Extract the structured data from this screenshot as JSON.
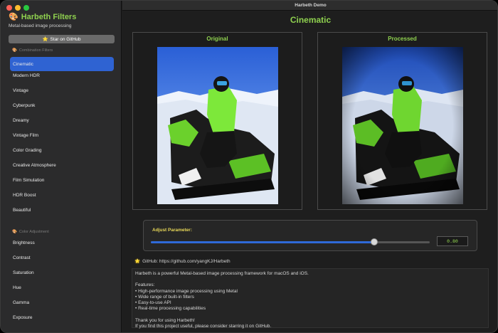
{
  "window": {
    "title": "Harbeth Demo"
  },
  "sidebar": {
    "app_title": "Harbeth Filters",
    "app_subtitle": "Metal-based image processing",
    "star_button": "Star on GitHub",
    "combination_header": "Combination Filters",
    "combination_items": [
      {
        "label": "Cinematic",
        "active": true
      },
      {
        "label": "Modern HDR"
      },
      {
        "label": "Vintage"
      },
      {
        "label": "Cyberpunk"
      },
      {
        "label": "Dreamy"
      },
      {
        "label": "Vintage Film"
      },
      {
        "label": "Color Grading"
      },
      {
        "label": "Creative Atmosphere"
      },
      {
        "label": "Film Simulation"
      },
      {
        "label": "HDR Boost"
      },
      {
        "label": "Beautiful"
      }
    ],
    "color_header": "Color Adjustment",
    "color_items": [
      {
        "label": "Brightness"
      },
      {
        "label": "Contrast"
      },
      {
        "label": "Saturation"
      },
      {
        "label": "Hue"
      },
      {
        "label": "Gamma"
      },
      {
        "label": "Exposure"
      }
    ]
  },
  "main": {
    "title": "Cinematic",
    "original_label": "Original",
    "processed_label": "Processed",
    "adjust_label": "Adjust Parameter:",
    "slider_fraction": 0.8,
    "value_text": "0.80",
    "github_text": "GitHub: https://github.com/yangKJ/Harbeth",
    "info_text": "Harbeth is a powerful Metal-based image processing framework for macOS and iOS.\n\nFeatures:\n• High-performance image processing using Metal\n• Wide range of built-in filters\n• Easy-to-use API\n• Real-time processing capabilities\n\nThank you for using Harbeth!\nIf you find this project useful, please consider starring it on GitHub."
  },
  "colors": {
    "accent_green": "#8fd14f",
    "selection_blue": "#2f63d2",
    "slider_blue": "#2f6ad8"
  }
}
